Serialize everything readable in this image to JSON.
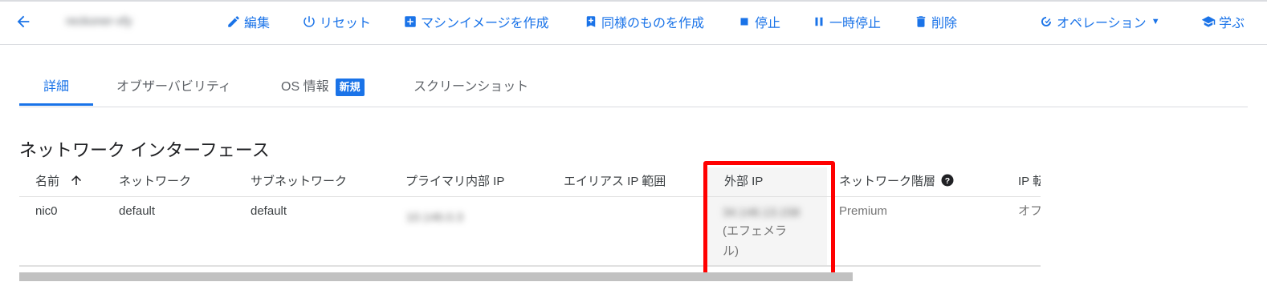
{
  "toolbar": {
    "instance_name": "reckoner-xfy",
    "actions": {
      "edit": "編集",
      "reset": "リセット",
      "create_image": "マシンイメージを作成",
      "create_similar": "同様のものを作成",
      "stop": "停止",
      "suspend": "一時停止",
      "delete": "削除",
      "operations": "オペレーション",
      "learn": "学ぶ"
    }
  },
  "tabs": {
    "details": "詳細",
    "observability": "オブザーバビリティ",
    "os_info": "OS 情報",
    "os_info_badge": "新規",
    "screenshot": "スクリーンショット"
  },
  "section": {
    "title": "ネットワーク インターフェース"
  },
  "table": {
    "headers": {
      "name": "名前",
      "network": "ネットワーク",
      "subnetwork": "サブネットワーク",
      "primary_ip": "プライマリ内部 IP",
      "alias_ip": "エイリアス IP 範囲",
      "external_ip": "外部 IP",
      "tier": "ネットワーク階層",
      "ip_forward": "IP 転"
    },
    "rows": [
      {
        "name": "nic0",
        "network": "default",
        "subnetwork": "default",
        "primary_ip": "10.146.0.3",
        "alias_ip": "",
        "external_ip": "34.146.13.158",
        "external_ip_type_line1": "(エフェメラ",
        "external_ip_type_line2": "ル)",
        "tier": "Premium",
        "ip_forward": "オフ"
      }
    ]
  },
  "colors": {
    "accent": "#1a73e8",
    "highlight": "#ff0000"
  }
}
